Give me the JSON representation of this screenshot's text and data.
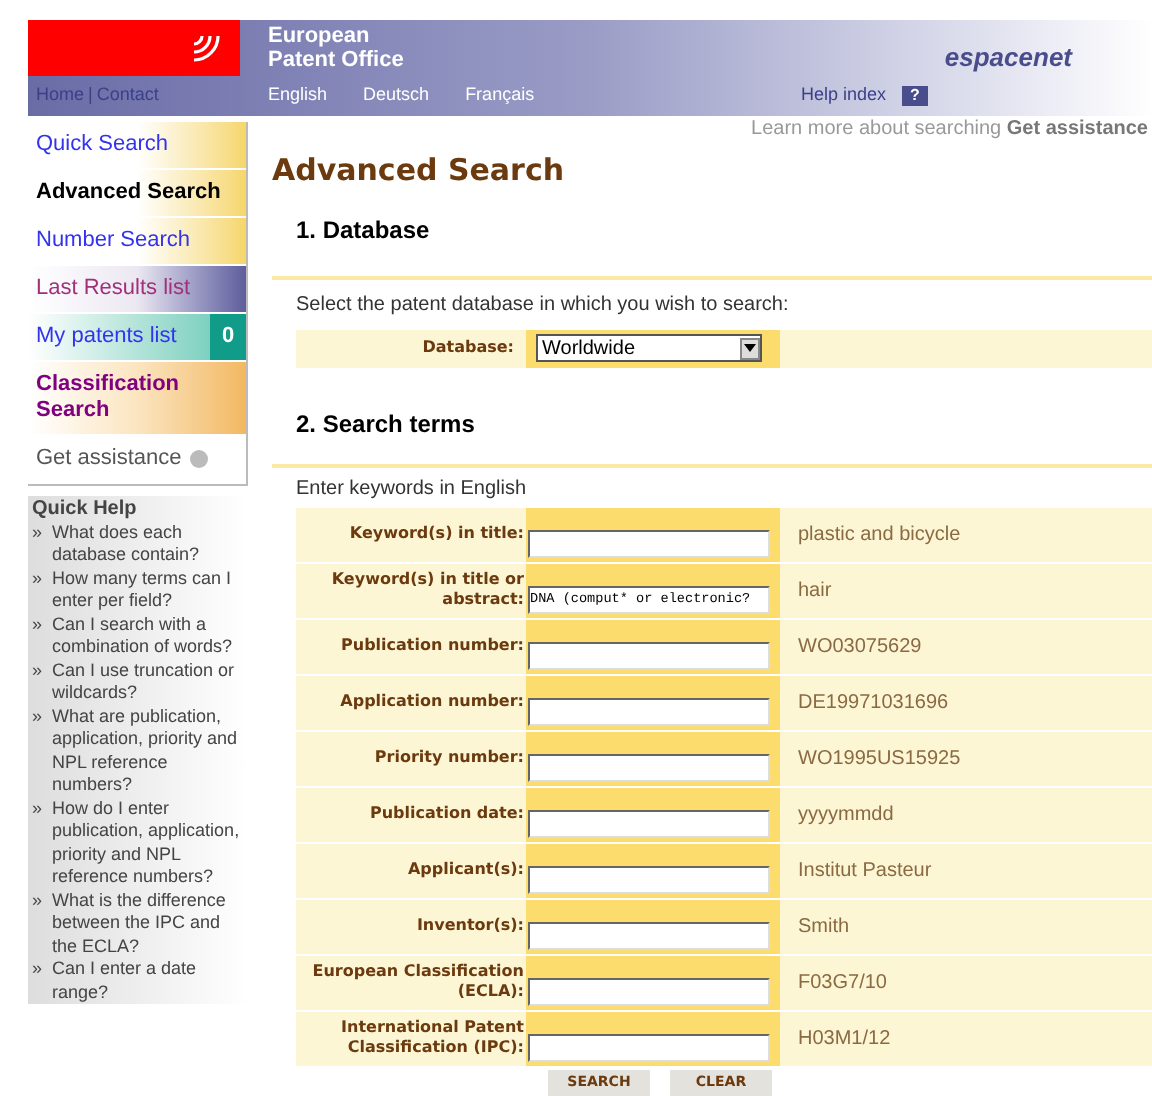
{
  "header": {
    "org_line1": "European",
    "org_line2": "Patent Office",
    "brand": "espacenet",
    "links": [
      "Home",
      "Contact"
    ],
    "link_separator": "|",
    "languages": [
      "English",
      "Deutsch",
      "Français"
    ],
    "help_index": "Help index",
    "help_badge": "?"
  },
  "sidebar": {
    "items": [
      {
        "label": "Quick Search",
        "kind": "link",
        "selected": false
      },
      {
        "label": "Advanced Search",
        "kind": "link",
        "selected": true
      },
      {
        "label": "Number Search",
        "kind": "link",
        "selected": false
      },
      {
        "label": "Last Results list",
        "kind": "results",
        "selected": false
      },
      {
        "label": "My patents list",
        "kind": "patents",
        "selected": false,
        "count": "0"
      },
      {
        "label": "Classification Search",
        "kind": "classification",
        "selected": false
      },
      {
        "label": "Get assistance",
        "kind": "assistance",
        "selected": false
      }
    ],
    "quick_help": {
      "title": "Quick Help",
      "items": [
        "What does each database contain?",
        "How many terms can I enter per field?",
        "Can I search with a combination of words?",
        "Can I use truncation or wildcards?",
        "What are publication, application, priority and NPL reference numbers?",
        "How do I enter publication, application, priority and NPL reference numbers?",
        "What is the difference between the IPC and the ECLA?",
        "Can I enter a date range?"
      ],
      "bullet": "»"
    }
  },
  "assist_bar": {
    "text": "Learn more about searching",
    "link": "Get assistance"
  },
  "title": "Advanced Search",
  "database": {
    "heading": "1. Database",
    "intro": "Select the patent database in which you wish to search:",
    "label": "Database:",
    "value": "Worldwide"
  },
  "search_terms": {
    "heading": "2. Search terms",
    "intro": "Enter keywords in English",
    "fields": [
      {
        "label": "Keyword(s) in title:",
        "example": "plastic and bicycle"
      },
      {
        "label": "Keyword(s) in title or abstract:",
        "value": "DNA (comput* or electronic?",
        "example": "hair"
      },
      {
        "label": "Publication number:",
        "example": "WO03075629"
      },
      {
        "label": "Application number:",
        "example": "DE19971031696"
      },
      {
        "label": "Priority number:",
        "example": "WO1995US15925"
      },
      {
        "label": "Publication date:",
        "example": "yyyymmdd"
      },
      {
        "label": "Applicant(s):",
        "example": "Institut Pasteur"
      },
      {
        "label": "Inventor(s):",
        "example": "Smith"
      },
      {
        "label": "European Classification (ECLA):",
        "example": "F03G7/10"
      },
      {
        "label": "International Patent Classification (IPC):",
        "example": "H03M1/12"
      }
    ]
  },
  "buttons": [
    "SEARCH",
    "CLEAR"
  ]
}
